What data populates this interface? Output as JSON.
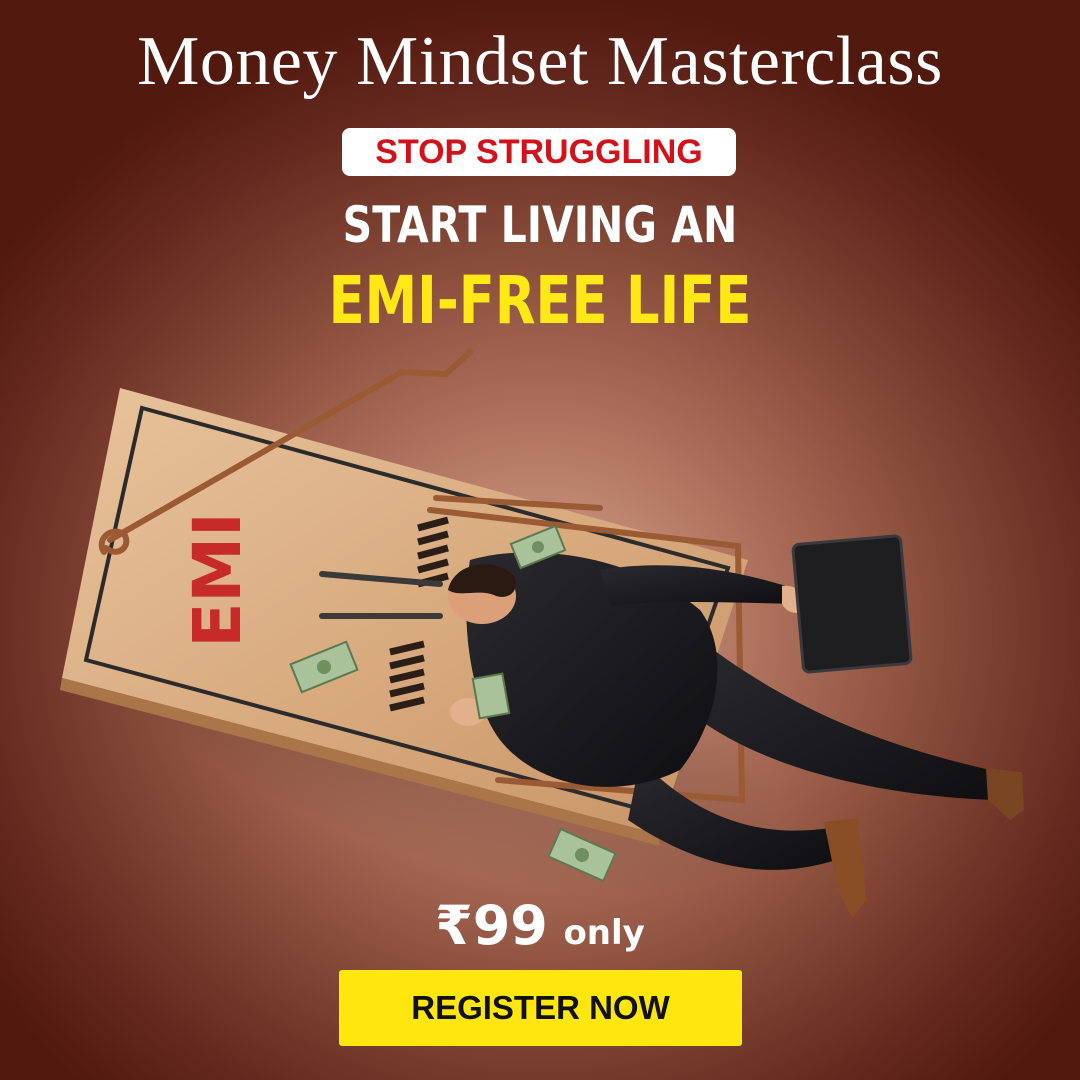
{
  "banner": {
    "title": "Money Mindset Masterclass",
    "tag": "STOP STRUGGLING",
    "headline_line1": "START LIVING AN",
    "headline_line2": "EMI-FREE LIFE",
    "trap_label": "EMI",
    "price": "₹99",
    "price_suffix": "only",
    "cta_label": "REGISTER NOW"
  },
  "colors": {
    "background_center": "#d7a590",
    "background_edge": "#52190f",
    "tag_text": "#d1121a",
    "headline_accent": "#ffe816",
    "cta_background": "#ffe60f",
    "cta_text": "#111111"
  },
  "icons": {
    "illustration": "businessman-caught-in-mousetrap-illustration",
    "money": "dollar-bill-icon",
    "briefcase": "briefcase-icon"
  }
}
